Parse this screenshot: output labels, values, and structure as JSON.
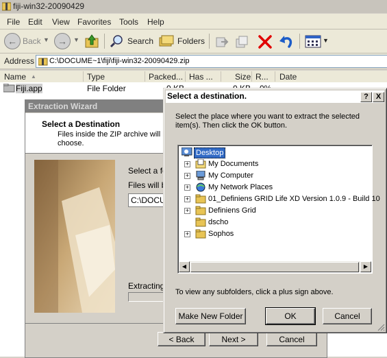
{
  "window": {
    "title": "fiji-win32-20090429"
  },
  "menu": {
    "file": "File",
    "edit": "Edit",
    "view": "View",
    "favorites": "Favorites",
    "tools": "Tools",
    "help": "Help"
  },
  "toolbar": {
    "back": "Back",
    "search": "Search",
    "folders": "Folders"
  },
  "address": {
    "label": "Address",
    "value": "C:\\DOCUME~1\\fiji\\fiji-win32-20090429.zip"
  },
  "columns": {
    "name": "Name",
    "type": "Type",
    "packed": "Packed...",
    "has": "Has ...",
    "size": "Size",
    "ratio": "R...",
    "date": "Date"
  },
  "files": [
    {
      "name": "Fiji.app",
      "type": "File Folder",
      "packed": "0 KB",
      "size": "0 KB",
      "ratio": "0%"
    }
  ],
  "wizard": {
    "title": "Extraction Wizard",
    "heading": "Select a Destination",
    "desc_line1": "Files inside the ZIP archive will b",
    "desc_line2": "choose.",
    "select_label": "Select a fo",
    "files_label": "Files will be",
    "path_value": "C:\\DOCU",
    "extracting": "Extracting.",
    "back_btn": "< Back",
    "next_btn": "Next >",
    "cancel_btn": "Cancel"
  },
  "dialog": {
    "title": "Select a destination.",
    "help_btn": "?",
    "close_btn": "X",
    "instr1": "Select the place where you want to extract the selected",
    "instr2": "item(s).  Then click the OK button.",
    "tree": [
      {
        "label": "Desktop",
        "icon": "desktop-icon",
        "selected": true
      },
      {
        "label": "My Documents",
        "icon": "my-documents-icon",
        "expand": "+"
      },
      {
        "label": "My Computer",
        "icon": "my-computer-icon",
        "expand": "+"
      },
      {
        "label": "My Network Places",
        "icon": "network-places-icon",
        "expand": "+"
      },
      {
        "label": "01_Definiens GRID Life XD Version 1.0.9 - Build 10",
        "icon": "folder-icon",
        "expand": "+"
      },
      {
        "label": "Definiens Grid",
        "icon": "folder-icon",
        "expand": "+"
      },
      {
        "label": "dscho",
        "icon": "folder-icon"
      },
      {
        "label": "Sophos",
        "icon": "folder-icon",
        "expand": "+"
      }
    ],
    "hint": "To view any subfolders, click a plus sign above.",
    "new_folder_btn": "Make New Folder",
    "ok_btn": "OK",
    "cancel_btn": "Cancel"
  },
  "colors": {
    "accent_red": "#e00000",
    "selection": "#316ac5",
    "folder": "#e8c455"
  }
}
